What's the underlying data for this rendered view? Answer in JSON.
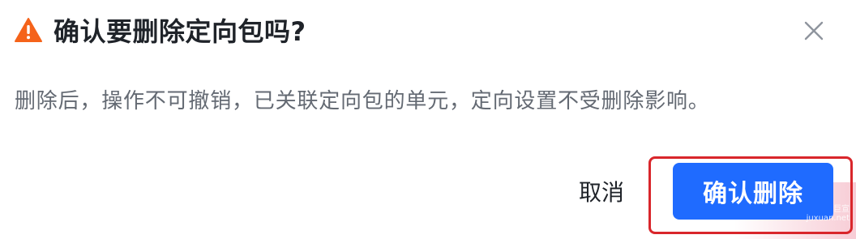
{
  "dialog": {
    "title": "确认要删除定向包吗?",
    "message": "删除后，操作不可撤销，已关联定向包的单元，定向设置不受删除影响。",
    "cancel_label": "取消",
    "confirm_label": "确认删除",
    "warning_color": "#f5631a",
    "primary_color": "#1f6bff",
    "highlight_color": "#d9262b"
  },
  "watermark": {
    "line1": "巨宣",
    "line2": "juxuan.net"
  }
}
